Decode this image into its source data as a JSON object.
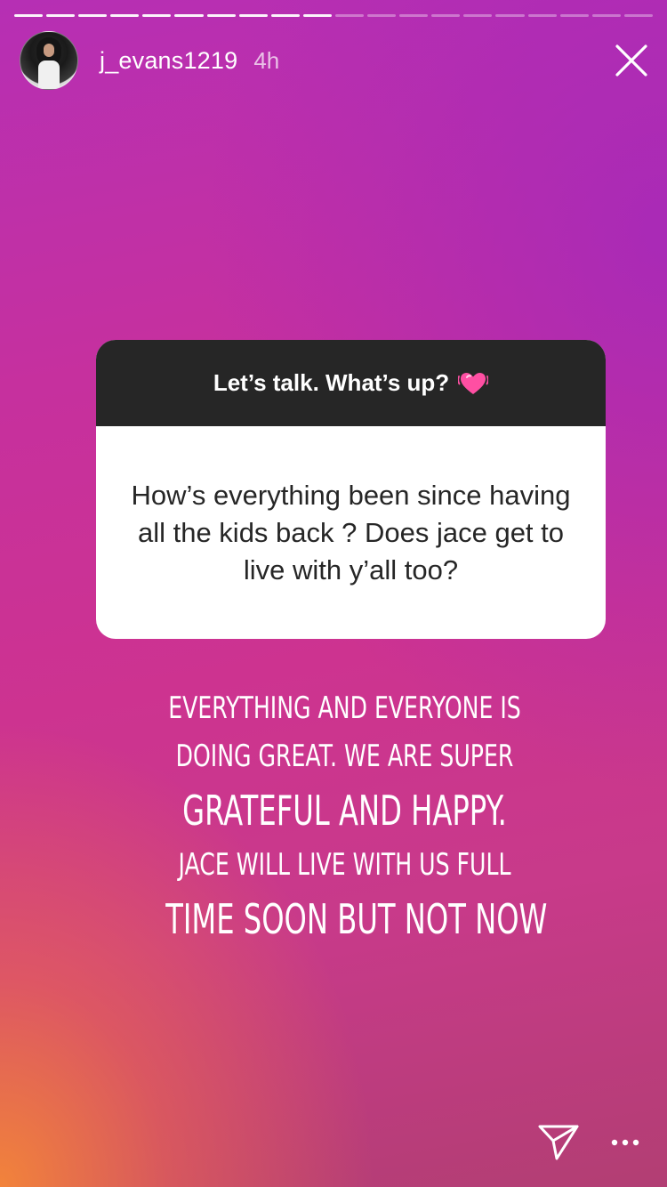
{
  "story": {
    "progress": {
      "segments_total": 20,
      "segments_completed": 10
    }
  },
  "header": {
    "username": "j_evans1219",
    "time_ago": "4h"
  },
  "question_sticker": {
    "prompt": "Let’s talk. What’s up?",
    "prompt_emoji": "heart-emoji",
    "question_text": "How’s everything been since having all the kids back ? Does jace get to live with y’all too?"
  },
  "answer": {
    "lines": [
      "EVERYTHING AND EVERYONE IS",
      "DOING GREAT. WE ARE SUPER",
      "GRATEFUL AND HAPPY.",
      "JACE WILL LIVE WITH US FULL",
      "TIME SOON BUT NOT NOW"
    ]
  },
  "icons": {
    "close": "close-icon",
    "send": "send-icon",
    "more": "more-icon"
  },
  "colors": {
    "background_top": "#b62fb4",
    "background_bottom_left": "#f58737",
    "sticker_header": "#262626",
    "sticker_body": "#ffffff",
    "text_white": "#ffffff"
  }
}
